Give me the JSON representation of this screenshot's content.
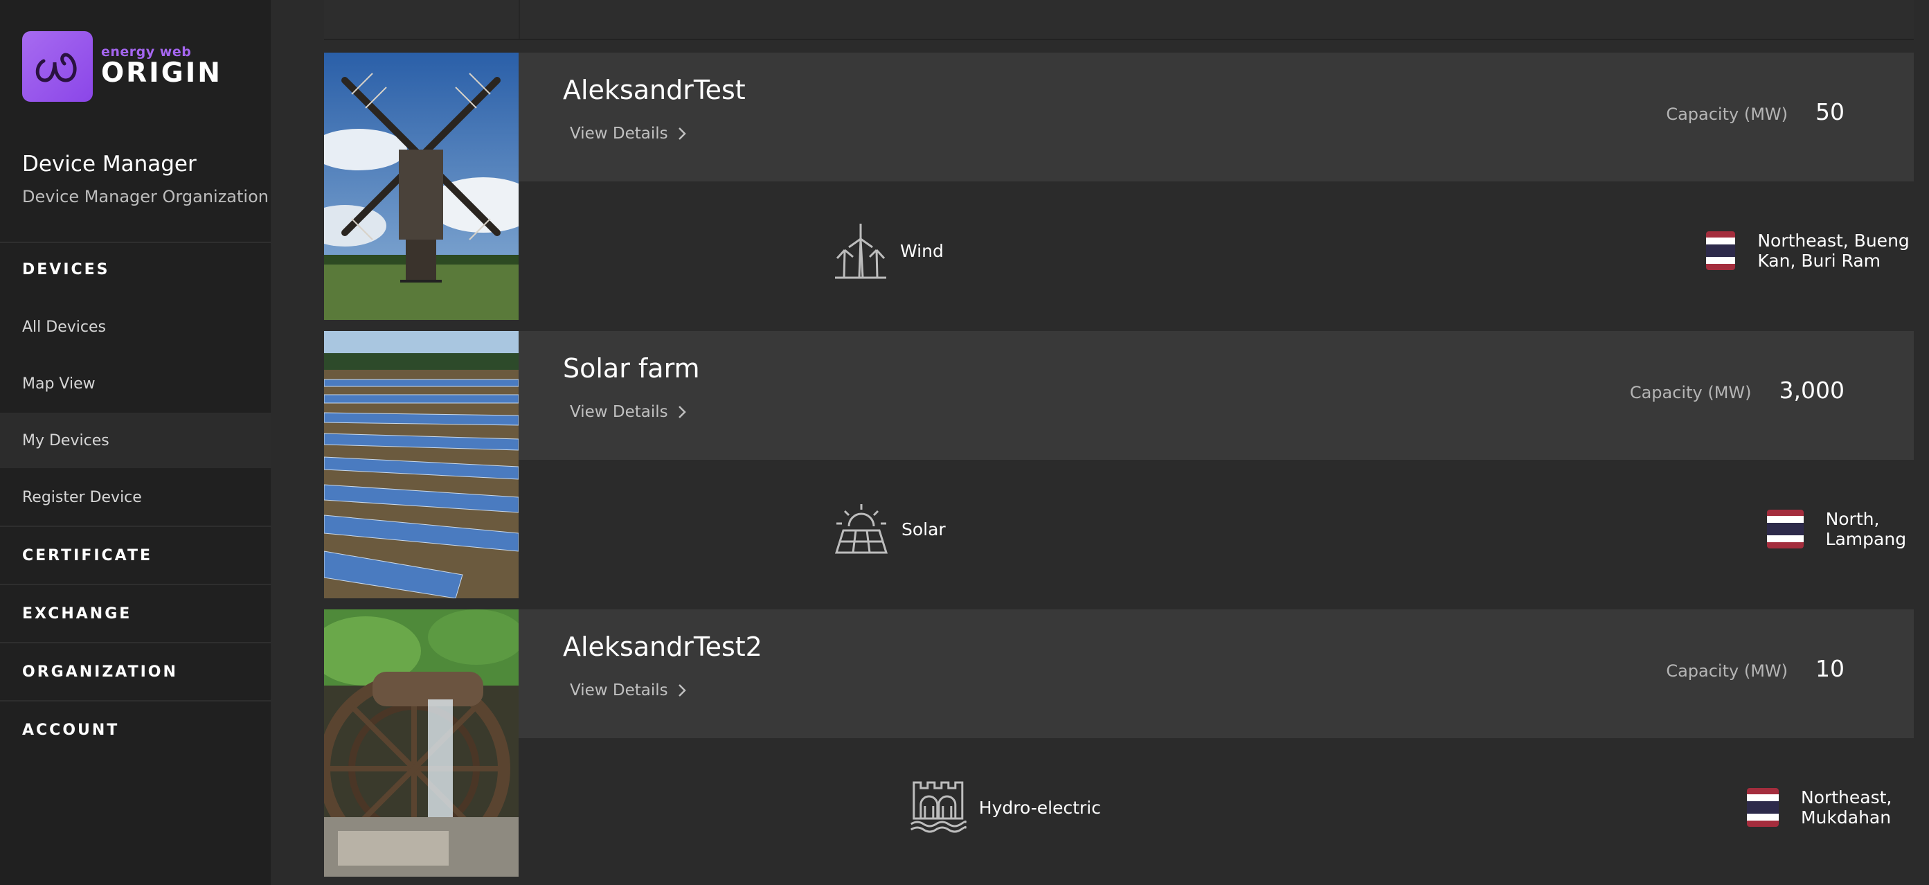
{
  "brand": {
    "small": "energy web",
    "big": "ORIGIN",
    "accent": "#a566f0"
  },
  "user": {
    "name": "Device Manager",
    "organization": "Device Manager Organization"
  },
  "nav": {
    "devices": "DEVICES",
    "items": [
      {
        "label": "All Devices",
        "active": false
      },
      {
        "label": "Map View",
        "active": false
      },
      {
        "label": "My Devices",
        "active": true
      },
      {
        "label": "Register Device",
        "active": false
      }
    ],
    "certificate": "CERTIFICATE",
    "exchange": "EXCHANGE",
    "organization": "ORGANIZATION",
    "account": "ACCOUNT"
  },
  "devices": [
    {
      "name": "AleksandrTest",
      "view_details": "View Details",
      "capacity_label": "Capacity (MW)",
      "capacity": "50",
      "type": "Wind",
      "type_icon": "wind-turbine-icon",
      "location": "Northeast, Bueng Kan, Buri Ram",
      "flag": "thailand-flag"
    },
    {
      "name": "Solar farm",
      "view_details": "View Details",
      "capacity_label": "Capacity (MW)",
      "capacity": "3,000",
      "type": "Solar",
      "type_icon": "solar-panel-icon",
      "location": "North, Lampang",
      "flag": "thailand-flag"
    },
    {
      "name": "AleksandrTest2",
      "view_details": "View Details",
      "capacity_label": "Capacity (MW)",
      "capacity": "10",
      "type": "Hydro-electric",
      "type_icon": "hydro-dam-icon",
      "location": "Northeast, Mukdahan",
      "flag": "thailand-flag"
    }
  ]
}
